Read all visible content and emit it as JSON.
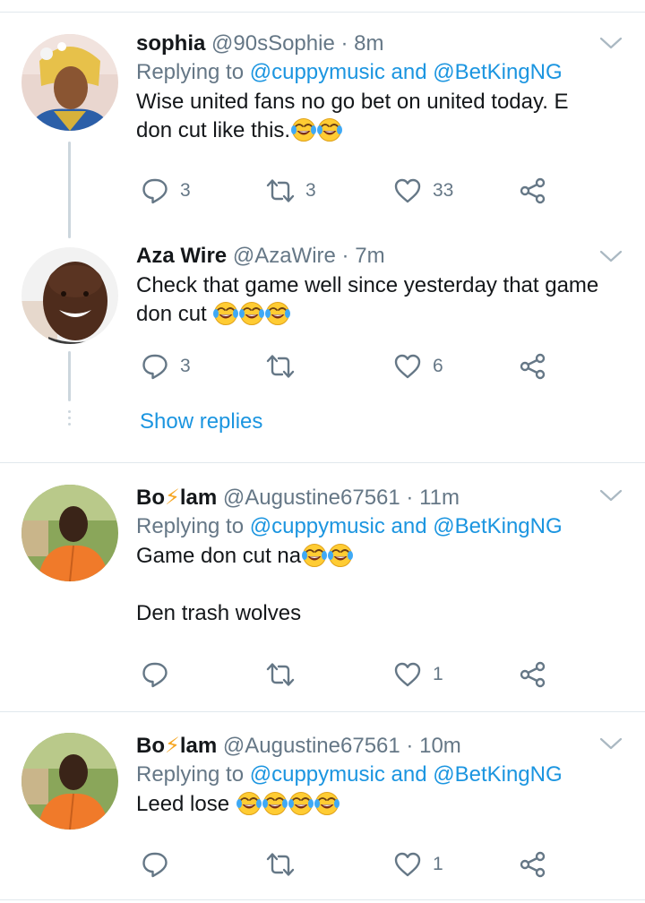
{
  "thread": {
    "show_replies_label": "Show replies"
  },
  "tweets": [
    {
      "name": "sophia",
      "handle": "@90sSophie",
      "separator": "·",
      "time": "8m",
      "replying_prefix": "Replying to",
      "replying_to": [
        "@cuppymusic",
        "@BetKingNG"
      ],
      "replying_join": "and",
      "lines": [
        "Wise united fans no go bet on united today. E",
        "don cut like this."
      ],
      "emoji_count": 2,
      "replies": "3",
      "retweets": "3",
      "likes": "33",
      "avatar": "avatar-sophia"
    },
    {
      "name": "Aza Wire",
      "handle": "@AzaWire",
      "separator": "·",
      "time": "7m",
      "lines": [
        "Check that game well since yesterday that game",
        "don cut "
      ],
      "emoji_count": 3,
      "replies": "3",
      "retweets": "",
      "likes": "6",
      "avatar": "avatar-aza"
    },
    {
      "name_part1": "Bo",
      "name_bolt": "⚡",
      "name_part2": "lam",
      "handle": "@Augustine67561",
      "separator": "·",
      "time": "11m",
      "replying_prefix": "Replying to",
      "replying_to": [
        "@cuppymusic",
        "@BetKingNG"
      ],
      "replying_join": "and",
      "lines": [
        "Game don cut na",
        "Den trash wolves"
      ],
      "emoji_count": 2,
      "replies": "",
      "retweets": "",
      "likes": "1",
      "avatar": "avatar-bolam"
    },
    {
      "name_part1": "Bo",
      "name_bolt": "⚡",
      "name_part2": "lam",
      "handle": "@Augustine67561",
      "separator": "·",
      "time": "10m",
      "replying_prefix": "Replying to",
      "replying_to": [
        "@cuppymusic",
        "@BetKingNG"
      ],
      "replying_join": "and",
      "lines": [
        "Leed lose "
      ],
      "emoji_count": 4,
      "replies": "",
      "retweets": "",
      "likes": "1",
      "avatar": "avatar-bolam"
    }
  ],
  "colors": {
    "link": "#1b95e0",
    "muted": "#657786",
    "text": "#14171a",
    "divider": "#e1e8ed",
    "thread_line": "#ccd6dd",
    "bolt": "#f5a623"
  },
  "icons": {
    "reply": "reply-icon",
    "retweet": "retweet-icon",
    "like": "heart-icon",
    "share": "share-icon",
    "caret": "chevron-down-icon",
    "emoji": "face-with-tears-of-joy-emoji"
  }
}
